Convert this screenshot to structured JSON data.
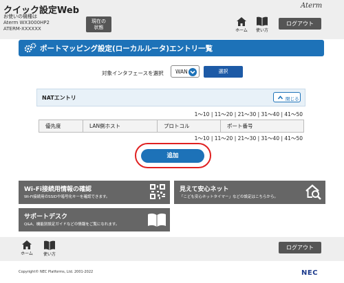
{
  "header": {
    "app_title": "クイック設定Web",
    "device_line1": "お使いの機種は",
    "device_line2": "Aterm WX3000HP2",
    "device_line3": "ATERM-XXXXXX",
    "status_btn_line1": "現在の",
    "status_btn_line2": "状態",
    "brand": "Aterm",
    "home_label": "ホーム",
    "help_label": "使い方",
    "logout_label": "ログアウト"
  },
  "page": {
    "title": "ポートマッピング設定(ローカルルータ)エントリ一覧"
  },
  "interface": {
    "label": "対象インタフェースを選択",
    "selected": "WAN",
    "select_button": "選択"
  },
  "nat": {
    "title": "NATエントリ",
    "close_label": "閉じる",
    "pages": [
      "1～10",
      "11～20",
      "21～30",
      "31～40",
      "41～50"
    ],
    "separator": " | ",
    "columns": [
      "優先度",
      "LAN側ホスト",
      "プロトコル",
      "ポート番号"
    ],
    "add_label": "追加"
  },
  "cards": {
    "wifi_title": "Wi-Fi接続用情報の確認",
    "wifi_sub": "Wi-Fi接続用のSSIDや暗号化キーを確認できます。",
    "safety_title": "見えて安心ネット",
    "safety_sub": "「こども安心ネットタイマー」などの設定はこちらから。",
    "support_title": "サポートデスク",
    "support_sub": "Q&A、機能別設定ガイドなどの情報をご覧になれます。"
  },
  "footer": {
    "home_label": "ホーム",
    "help_label": "使い方",
    "logout_label": "ログアウト",
    "copyright": "Copyright© NEC Platforms, Ltd. 2001-2022",
    "nec": "NEC"
  },
  "colors": {
    "accent": "#1d72b8",
    "dark_button": "#555555",
    "card_gray": "#666666",
    "highlight_ring": "#e02020"
  },
  "icons": {
    "home": "home-icon",
    "help": "book-icon",
    "gear": "gear-icon",
    "chevron": "chevron-down-icon",
    "collapse": "chevron-up-icon",
    "qr": "qr-code-icon",
    "house_search": "house-search-icon",
    "book": "open-book-icon"
  }
}
